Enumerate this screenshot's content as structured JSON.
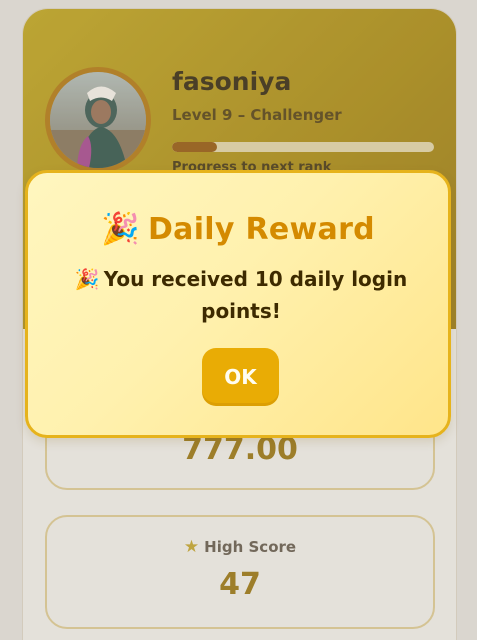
{
  "profile": {
    "username": "fasoniya",
    "level_text": "Level 9 – Challenger",
    "progress_label": "Progress to next rank",
    "progress_fraction": 0.17
  },
  "stats": [
    {
      "label": "",
      "value": "777.00"
    },
    {
      "label": "High Score",
      "value": "47",
      "icon": "star-icon"
    }
  ],
  "modal": {
    "title": "Daily Reward",
    "title_icon": "party-popper-icon",
    "message": "You received 10 daily login points!",
    "message_icon": "party-popper-icon",
    "ok_label": "OK"
  },
  "colors": {
    "accent": "#e9ac05",
    "header_gold": "#a98a0b",
    "modal_bg": "#fff1ae",
    "title": "#d48a00"
  }
}
